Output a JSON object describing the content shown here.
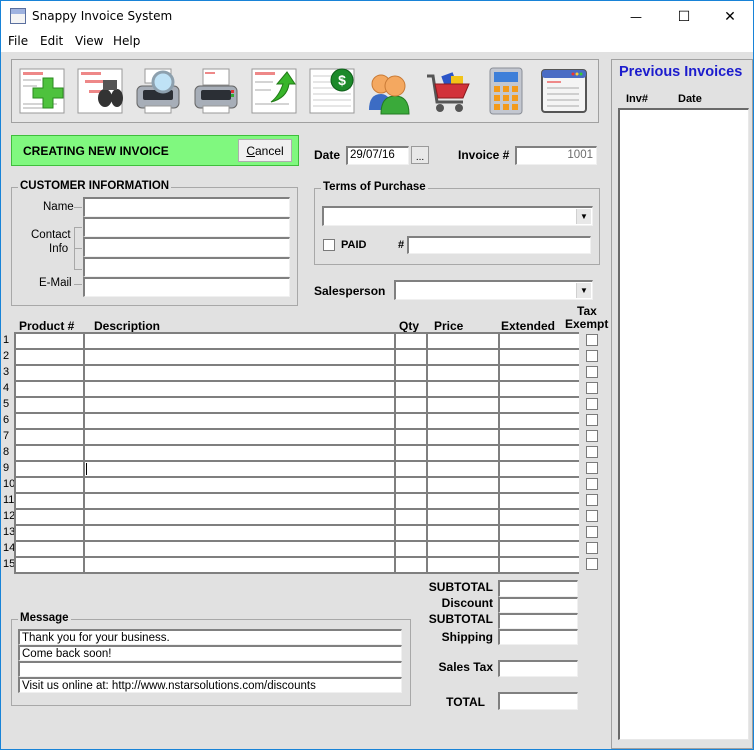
{
  "window": {
    "title": "Snappy Invoice System",
    "controls": {
      "minimize": "—",
      "maximize": "☐",
      "close": "✕"
    }
  },
  "menu": [
    "File",
    "Edit",
    "View",
    "Help"
  ],
  "toolbar": {
    "buttons": [
      {
        "name": "new-invoice",
        "icon": "document-plus-icon"
      },
      {
        "name": "find-invoice",
        "icon": "binoculars-icon"
      },
      {
        "name": "print-preview",
        "icon": "printer-magnifier-icon"
      },
      {
        "name": "print",
        "icon": "printer-icon"
      },
      {
        "name": "export",
        "icon": "document-arrow-icon"
      },
      {
        "name": "payments",
        "icon": "ledger-dollar-icon"
      },
      {
        "name": "customers",
        "icon": "people-icon"
      },
      {
        "name": "products",
        "icon": "shopping-cart-icon"
      },
      {
        "name": "calculator",
        "icon": "calculator-icon"
      },
      {
        "name": "invoice-template",
        "icon": "window-invoice-icon"
      }
    ]
  },
  "status": {
    "text": "CREATING NEW INVOICE",
    "cancel_label_underlined": "C",
    "cancel_label_rest": "ancel",
    "color": "#80f87f"
  },
  "invoice": {
    "date_label": "Date",
    "date_value": "29/07/16",
    "date_picker_label": "...",
    "number_label": "Invoice #",
    "number_value": "1001"
  },
  "customer": {
    "group_label": "CUSTOMER INFORMATION",
    "name_label": "Name",
    "contact_label_1": "Contact",
    "contact_label_2": "Info",
    "email_label": "E-Mail",
    "name_value": "",
    "contact_values": [
      "",
      "",
      ""
    ],
    "email_value": ""
  },
  "terms": {
    "group_label": "Terms of Purchase",
    "selected": "",
    "paid_label": "PAID",
    "paid_checked": false,
    "number_label": "#",
    "number_value": ""
  },
  "salesperson": {
    "label": "Salesperson",
    "selected": ""
  },
  "grid": {
    "headers": {
      "product": "Product #",
      "description": "Description",
      "qty": "Qty",
      "price": "Price",
      "extended": "Extended",
      "tax1": "Tax",
      "tax2": "Exempt"
    },
    "rows": [
      "1",
      "2",
      "3",
      "4",
      "5",
      "6",
      "7",
      "8",
      "9",
      "10",
      "11",
      "12",
      "13",
      "14",
      "15"
    ]
  },
  "totals": {
    "subtotal_label": "SUBTOTAL",
    "discount_label": "Discount",
    "subtotal2_label": "SUBTOTAL",
    "shipping_label": "Shipping",
    "sales_tax_label": "Sales Tax",
    "total_label": "TOTAL",
    "subtotal": "",
    "discount": "",
    "subtotal2": "",
    "shipping": "",
    "sales_tax": "",
    "total": ""
  },
  "message": {
    "group_label": "Message",
    "lines": [
      "Thank you for your business.",
      "Come back soon!",
      "",
      "Visit us online at: http://www.nstarsolutions.com/discounts"
    ]
  },
  "previous_invoices": {
    "title": "Previous Invoices",
    "col_inv": "Inv#",
    "col_date": "Date",
    "title_color": "#1c1ccd"
  }
}
